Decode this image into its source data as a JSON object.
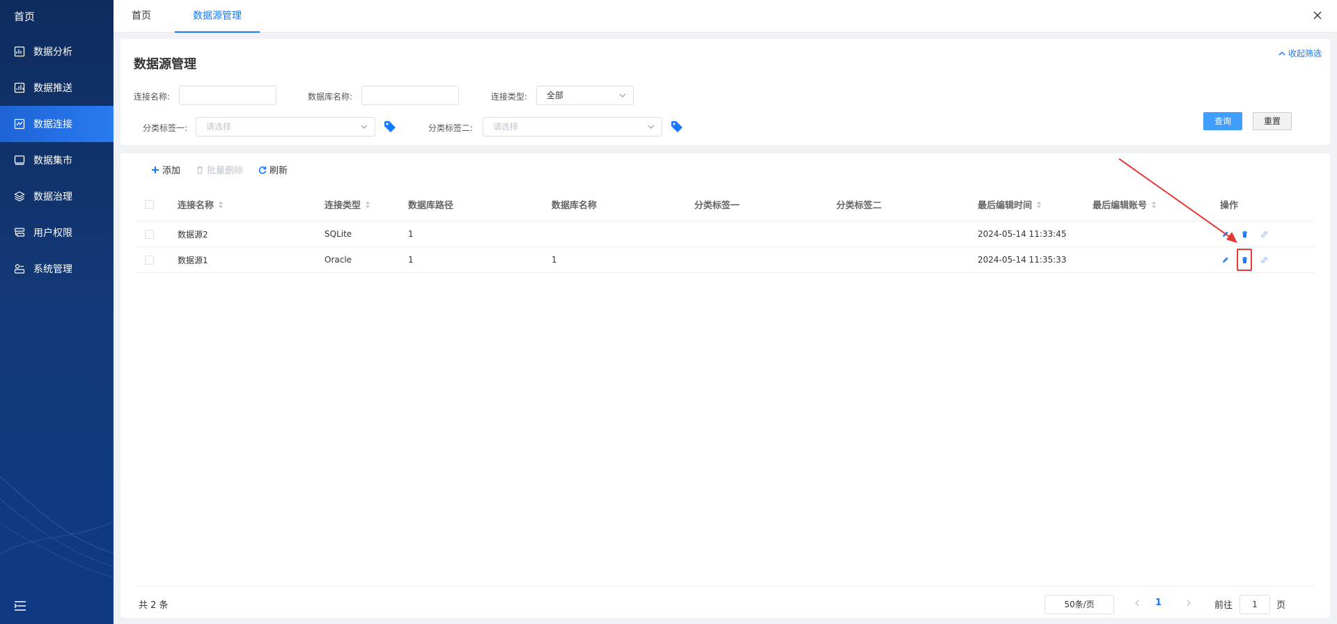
{
  "sidebar": {
    "brand": "首页",
    "items": [
      {
        "label": "数据分析",
        "icon": "analysis-icon"
      },
      {
        "label": "数据推送",
        "icon": "push-icon"
      },
      {
        "label": "数据连接",
        "icon": "connect-icon",
        "active": true
      },
      {
        "label": "数据集市",
        "icon": "mart-icon"
      },
      {
        "label": "数据治理",
        "icon": "governance-icon"
      },
      {
        "label": "用户权限",
        "icon": "user-permission-icon"
      },
      {
        "label": "系统管理",
        "icon": "system-icon"
      }
    ]
  },
  "tabs": [
    {
      "label": "首页"
    },
    {
      "label": "数据源管理",
      "active": true
    }
  ],
  "filter": {
    "title": "数据源管理",
    "fold_label": "收起筛选",
    "conn_name_label": "连接名称:",
    "db_name_label": "数据库名称:",
    "conn_type_label": "连接类型:",
    "conn_type_value": "全部",
    "tag1_label": "分类标签一:",
    "tag1_placeholder": "请选择",
    "tag2_label": "分类标签二:",
    "tag2_placeholder": "请选择",
    "query_btn": "查询",
    "reset_btn": "重置"
  },
  "toolbar": {
    "add": "添加",
    "batch_delete": "批量删除",
    "refresh": "刷新"
  },
  "table": {
    "headers": [
      "连接名称",
      "连接类型",
      "数据库路径",
      "数据库名称",
      "分类标签一",
      "分类标签二",
      "最后编辑时间",
      "最后编辑账号",
      "操作"
    ],
    "rows": [
      {
        "name": "数据源2",
        "type": "SQLite",
        "path": "1",
        "db": "",
        "tag1": "",
        "tag2": "",
        "time": "2024-05-14 11:33:45",
        "account": ""
      },
      {
        "name": "数据源1",
        "type": "Oracle",
        "path": "1",
        "db": "1",
        "tag1": "",
        "tag2": "",
        "time": "2024-05-14 11:35:33",
        "account": ""
      }
    ]
  },
  "pagination": {
    "total": "共 2 条",
    "page_size": "50条/页",
    "current": "1",
    "goto_label": "前往",
    "goto_value": "1",
    "page_suffix": "页"
  },
  "colors": {
    "accent": "#1677ff",
    "annotation": "#e53935"
  }
}
